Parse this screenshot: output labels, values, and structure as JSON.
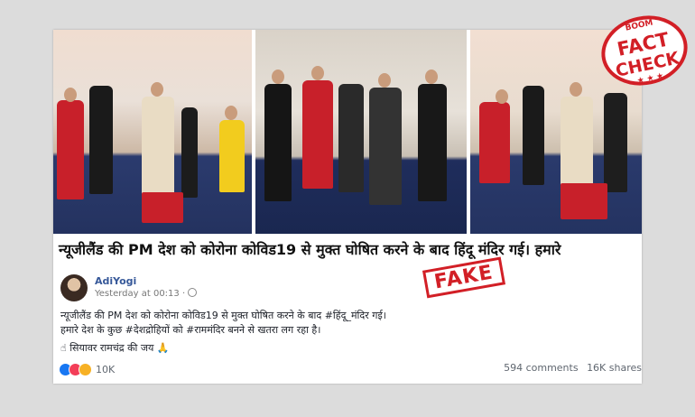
{
  "caption": "न्यूजीलैंड की PM देश को कोरोना कोविड19 से मुक्त घोषित करने के बाद हिंदू मंदिर गई। हमारे",
  "post": {
    "author": "AdiYogi",
    "time": "Yesterday at 00:13 ·",
    "line1": "न्यूजीलैंड की PM देश को कोरोना कोविड19 से मुक्त घोषित करने के बाद #हिंदू_मंदिर गई।",
    "line2": "हमारे देश के कुछ #देशद्रोहियों को #राममंदिर बनने से खतरा लग रहा है।",
    "line3": "☝ सियावर रामचंद्र की जय 🙏",
    "reaction_count": "10K",
    "comments": "594 comments",
    "shares": "16K shares"
  },
  "stamp": "FAKE",
  "badge": {
    "top": "BOOM",
    "line1": "FACT",
    "line2": "CHECK",
    "color": "#d21f26"
  },
  "reaction_icons": [
    "like-icon",
    "love-icon",
    "wow-icon"
  ]
}
